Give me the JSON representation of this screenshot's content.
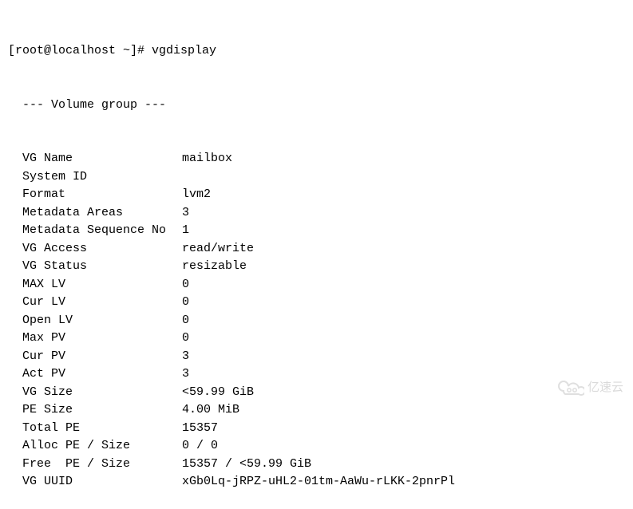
{
  "prompt": {
    "user_host": "[root@localhost ~]#",
    "command": "vgdisplay"
  },
  "header": "  --- Volume group ---",
  "entries": [
    {
      "label": "VG Name",
      "value": "mailbox"
    },
    {
      "label": "System ID",
      "value": ""
    },
    {
      "label": "Format",
      "value": "lvm2"
    },
    {
      "label": "Metadata Areas",
      "value": "3"
    },
    {
      "label": "Metadata Sequence No",
      "value": "1"
    },
    {
      "label": "VG Access",
      "value": "read/write"
    },
    {
      "label": "VG Status",
      "value": "resizable"
    },
    {
      "label": "MAX LV",
      "value": "0"
    },
    {
      "label": "Cur LV",
      "value": "0"
    },
    {
      "label": "Open LV",
      "value": "0"
    },
    {
      "label": "Max PV",
      "value": "0"
    },
    {
      "label": "Cur PV",
      "value": "3"
    },
    {
      "label": "Act PV",
      "value": "3"
    },
    {
      "label": "VG Size",
      "value": "<59.99 GiB"
    },
    {
      "label": "PE Size",
      "value": "4.00 MiB"
    },
    {
      "label": "Total PE",
      "value": "15357"
    },
    {
      "label": "Alloc PE / Size",
      "value": "0 / 0"
    },
    {
      "label": "Free  PE / Size",
      "value": "15357 / <59.99 GiB"
    },
    {
      "label": "VG UUID",
      "value": "xGb0Lq-jRPZ-uHL2-01tm-AaWu-rLKK-2pnrPl"
    }
  ],
  "watermark": {
    "text": "亿速云"
  }
}
